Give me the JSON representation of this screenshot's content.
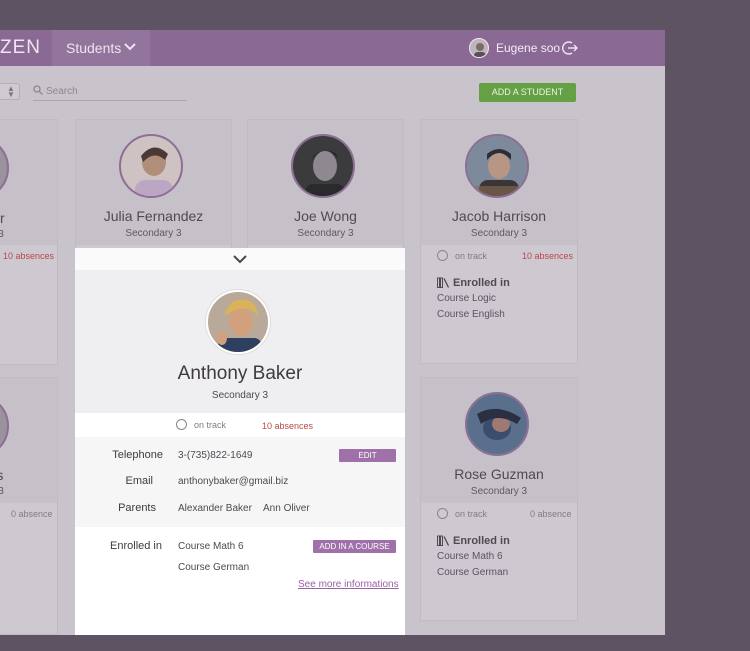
{
  "header": {
    "brand": "ZEN",
    "nav_label": "Students",
    "user_name": "Eugene soo"
  },
  "toolbar": {
    "search_placeholder": "Search",
    "add_student_label": "ADD A STUDENT"
  },
  "cards": [
    {
      "name": "aker",
      "grade": "3",
      "absences": "10 absences"
    },
    {
      "name": "Julia Fernandez",
      "grade": "Secondary 3"
    },
    {
      "name": "Joe Wong",
      "grade": "Secondary 3"
    },
    {
      "name": "Jacob Harrison",
      "grade": "Secondary 3",
      "status": "on track",
      "absences": "10 absences",
      "enrolled_title": "Enrolled in",
      "courses": [
        "Course Logic",
        "Course  English"
      ]
    },
    {
      "name": "rtis",
      "grade": "3",
      "absences": "0 absence"
    },
    {
      "name": "Rose Guzman",
      "grade": "Secondary 3",
      "status": "on track",
      "absences": "0 absence",
      "enrolled_title": "Enrolled in",
      "courses": [
        "Course Math 6",
        "Course  German"
      ]
    }
  ],
  "detail": {
    "name": "Anthony Baker",
    "grade": "Secondary 3",
    "status": "on track",
    "absences": "10 absences",
    "telephone_label": "Telephone",
    "telephone": "3-(735)822-1649",
    "edit_label": "EDIT",
    "email_label": "Email",
    "email": "anthonybaker@gmail.biz",
    "parents_label": "Parents",
    "parents": [
      "Alexander Baker",
      "Ann Oliver"
    ],
    "enrolled_label": "Enrolled in",
    "courses": [
      "Course Math 6",
      "Course  German"
    ],
    "add_course_label": "ADD IN A COURSE",
    "more_link": "See more informations"
  },
  "colors": {
    "header": "#8a6a94",
    "accent": "#a071a9",
    "add_button": "#66a046",
    "absence": "#b9494a"
  }
}
